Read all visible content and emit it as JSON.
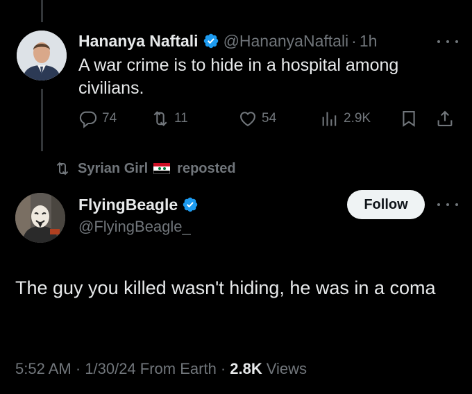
{
  "tweet1": {
    "author_name": "Hananya Naftali",
    "handle": "@HananyaNaftali",
    "separator": "·",
    "time": "1h",
    "text": "A war crime is to hide in a hospital among civilians.",
    "stats": {
      "replies": "74",
      "reposts": "11",
      "likes": "54",
      "views": "2.9K"
    }
  },
  "repost": {
    "user": "Syrian Girl",
    "label": "reposted"
  },
  "tweet2": {
    "author_name": "FlyingBeagle",
    "handle": "@FlyingBeagle_",
    "follow_label": "Follow",
    "text": "The guy you killed wasn't hiding, he was in a coma",
    "timestamp": "5:52 AM · 1/30/24 From Earth ·",
    "views_count": "2.8K",
    "views_label": "Views"
  },
  "colors": {
    "background": "#000000",
    "text": "#e7e9ea",
    "muted": "#71767b",
    "verified": "#1d9bf0"
  },
  "icons": [
    "reply-icon",
    "repost-icon",
    "like-icon",
    "views-icon",
    "bookmark-icon",
    "share-icon",
    "verified-badge-icon",
    "more-icon",
    "syria-flag-icon"
  ]
}
